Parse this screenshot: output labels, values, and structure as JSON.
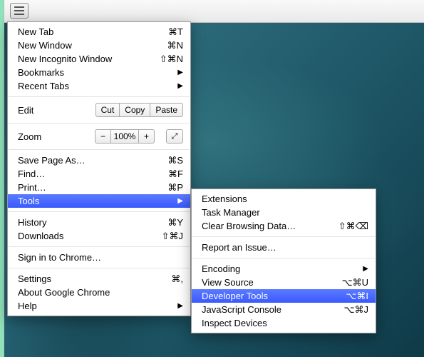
{
  "menu": {
    "new_tab": "New Tab",
    "new_tab_sc": "⌘T",
    "new_window": "New Window",
    "new_window_sc": "⌘N",
    "new_incognito": "New Incognito Window",
    "new_incognito_sc": "⇧⌘N",
    "bookmarks": "Bookmarks",
    "recent_tabs": "Recent Tabs",
    "edit": "Edit",
    "cut": "Cut",
    "copy": "Copy",
    "paste": "Paste",
    "zoom": "Zoom",
    "zoom_pct": "100%",
    "zoom_minus": "−",
    "zoom_plus": "+",
    "save_page": "Save Page As…",
    "save_page_sc": "⌘S",
    "find": "Find…",
    "find_sc": "⌘F",
    "print": "Print…",
    "print_sc": "⌘P",
    "tools": "Tools",
    "history": "History",
    "history_sc": "⌘Y",
    "downloads": "Downloads",
    "downloads_sc": "⇧⌘J",
    "signin": "Sign in to Chrome…",
    "settings": "Settings",
    "settings_sc": "⌘,",
    "about": "About Google Chrome",
    "help": "Help"
  },
  "submenu": {
    "extensions": "Extensions",
    "task_manager": "Task Manager",
    "clear_browsing": "Clear Browsing Data…",
    "clear_browsing_sc": "⇧⌘⌫",
    "report_issue": "Report an Issue…",
    "encoding": "Encoding",
    "view_source": "View Source",
    "view_source_sc": "⌥⌘U",
    "dev_tools": "Developer Tools",
    "dev_tools_sc": "⌥⌘I",
    "js_console": "JavaScript Console",
    "js_console_sc": "⌥⌘J",
    "inspect_devices": "Inspect Devices"
  }
}
